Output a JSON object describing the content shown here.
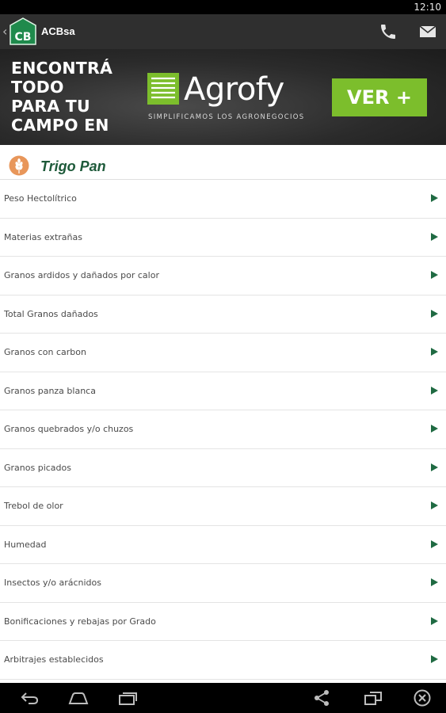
{
  "status_bar": {
    "time": "12:10"
  },
  "action_bar": {
    "title": "ACBsa",
    "logo_text": "CB",
    "icons": [
      "chevron-left-icon",
      "phone-icon",
      "mail-icon"
    ]
  },
  "banner": {
    "lines": [
      "ENCONTRÁ",
      "TODO",
      "PARA TU",
      "CAMPO EN"
    ],
    "brand": "Agrofy",
    "tagline": "SIMPLIFICAMOS LOS AGRONEGOCIOS",
    "cta": "VER +",
    "colors": {
      "cta": "#7cbe2c",
      "background": "#2b2b2b"
    }
  },
  "section": {
    "title": "Trigo Pan",
    "icon": "wheat-icon",
    "title_color": "#1e5a3a"
  },
  "items": [
    {
      "label": "Peso Hectolítrico"
    },
    {
      "label": "Materias extrañas"
    },
    {
      "label": "Granos ardidos y dañados por calor"
    },
    {
      "label": "Total Granos dañados"
    },
    {
      "label": "Granos con carbon"
    },
    {
      "label": "Granos panza blanca"
    },
    {
      "label": "Granos quebrados y/o chuzos"
    },
    {
      "label": "Granos picados"
    },
    {
      "label": "Trebol de olor"
    },
    {
      "label": "Humedad"
    },
    {
      "label": "Insectos y/o arácnidos"
    },
    {
      "label": "Bonificaciones y rebajas por Grado"
    },
    {
      "label": "Arbitrajes establecidos"
    }
  ],
  "nav_bar": {
    "icons": [
      "back-icon",
      "home-icon",
      "recent-apps-icon",
      "share-icon",
      "window-icon",
      "close-icon"
    ]
  }
}
